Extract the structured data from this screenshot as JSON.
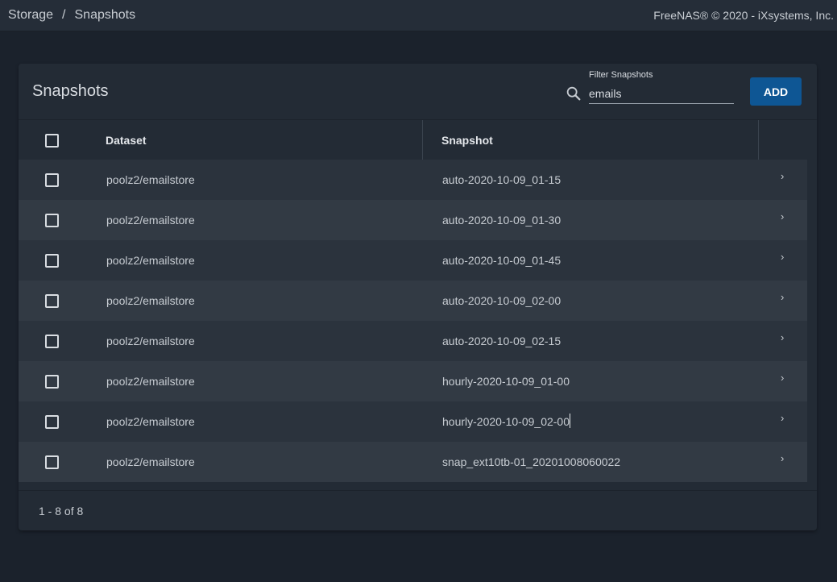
{
  "topbar": {
    "breadcrumb": [
      "Storage",
      "Snapshots"
    ],
    "separator": "/",
    "copyright": "FreeNAS® © 2020 - iXsystems, Inc."
  },
  "card": {
    "title": "Snapshots",
    "filter": {
      "label": "Filter Snapshots",
      "value": "emails"
    },
    "add_label": "ADD"
  },
  "table": {
    "columns": [
      "Dataset",
      "Snapshot"
    ],
    "rows": [
      {
        "dataset": "poolz2/emailstore",
        "snapshot": "auto-2020-10-09_01-15"
      },
      {
        "dataset": "poolz2/emailstore",
        "snapshot": "auto-2020-10-09_01-30"
      },
      {
        "dataset": "poolz2/emailstore",
        "snapshot": "auto-2020-10-09_01-45"
      },
      {
        "dataset": "poolz2/emailstore",
        "snapshot": "auto-2020-10-09_02-00"
      },
      {
        "dataset": "poolz2/emailstore",
        "snapshot": "auto-2020-10-09_02-15"
      },
      {
        "dataset": "poolz2/emailstore",
        "snapshot": "hourly-2020-10-09_01-00"
      },
      {
        "dataset": "poolz2/emailstore",
        "snapshot": "hourly-2020-10-09_02-00"
      },
      {
        "dataset": "poolz2/emailstore",
        "snapshot": "snap_ext10tb-01_20201008060022"
      }
    ],
    "expand_glyph": "›"
  },
  "footer": {
    "range": "1 - 8 of 8"
  },
  "colors": {
    "accent": "#0e5694",
    "background": "#1b222c",
    "card": "#232b35"
  },
  "icons": {
    "search": "search-icon",
    "expand": "chevron-right-icon",
    "checkbox": "checkbox-icon"
  }
}
